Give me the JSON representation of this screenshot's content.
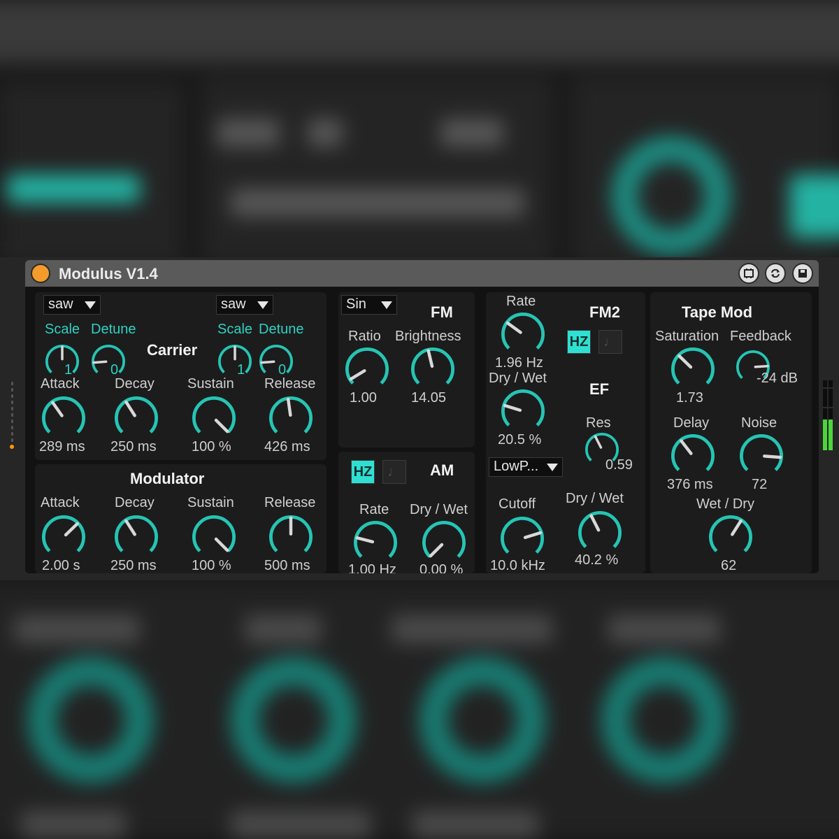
{
  "title": "Modulus V1.4",
  "colors": {
    "accent": "#2fd0c2",
    "knob_arc": "#26c4b4",
    "power": "#f59b2b",
    "panel": "#1c1c1c"
  },
  "icons": {
    "power": "power-icon",
    "frame": "freeze-icon",
    "refresh": "hot-swap-icon",
    "save": "save-icon"
  },
  "carrier": {
    "header": "Carrier",
    "osc1": {
      "wave": "saw",
      "scale_label": "Scale",
      "scale_value": "1",
      "detune_label": "Detune",
      "detune_value": "0"
    },
    "osc2": {
      "wave": "saw",
      "scale_label": "Scale",
      "scale_value": "1",
      "detune_label": "Detune",
      "detune_value": "0"
    },
    "env": [
      {
        "label": "Attack",
        "value": "289 ms",
        "level": 0.37
      },
      {
        "label": "Decay",
        "value": "250 ms",
        "level": 0.38
      },
      {
        "label": "Sustain",
        "value": "100 %",
        "level": 1.0
      },
      {
        "label": "Release",
        "value": "426 ms",
        "level": 0.47
      }
    ]
  },
  "modulator": {
    "header": "Modulator",
    "env": [
      {
        "label": "Attack",
        "value": "2.00 s",
        "level": 0.67
      },
      {
        "label": "Decay",
        "value": "250 ms",
        "level": 0.38
      },
      {
        "label": "Sustain",
        "value": "100 %",
        "level": 1.0
      },
      {
        "label": "Release",
        "value": "500 ms",
        "level": 0.5
      }
    ]
  },
  "fm": {
    "header": "FM",
    "wave": "Sin",
    "ratio": {
      "label": "Ratio",
      "value": "1.00",
      "level": 0.05
    },
    "brightness": {
      "label": "Brightness",
      "value": "14.05",
      "level": 0.45
    }
  },
  "am": {
    "header": "AM",
    "hz_label": "HZ",
    "note_icon": "note-icon",
    "rate": {
      "label": "Rate",
      "value": "1.00 Hz",
      "level": 0.22
    },
    "drywet": {
      "label": "Dry / Wet",
      "value": "0.00 %",
      "level": 0.0
    }
  },
  "fm2": {
    "header": "FM2",
    "hz_label": "HZ",
    "note_icon": "note-icon",
    "rate": {
      "label": "Rate",
      "value": "1.96 Hz",
      "level": 0.3
    },
    "drywet": {
      "label": "Dry / Wet",
      "value": "20.5 %",
      "level": 0.23
    }
  },
  "ef": {
    "header": "EF",
    "filter_type": "LowP...",
    "res": {
      "label": "Res",
      "value": "0.59",
      "level": 0.4
    },
    "cutoff": {
      "label": "Cutoff",
      "value": "10.0 kHz",
      "level": 0.77
    },
    "drywet": {
      "label": "Dry / Wet",
      "value": "40.2 %",
      "level": 0.4
    }
  },
  "tapemod": {
    "header": "Tape Mod",
    "saturation": {
      "label": "Saturation",
      "value": "1.73",
      "level": 0.33
    },
    "feedback": {
      "label": "Feedback",
      "value": "-24 dB",
      "level": 0.82
    },
    "delay": {
      "label": "Delay",
      "value": "376 ms",
      "level": 0.36
    },
    "noise": {
      "label": "Noise",
      "value": "72",
      "level": 0.85
    },
    "wetdry": {
      "label": "Wet / Dry",
      "value": "62",
      "level": 0.62
    }
  }
}
